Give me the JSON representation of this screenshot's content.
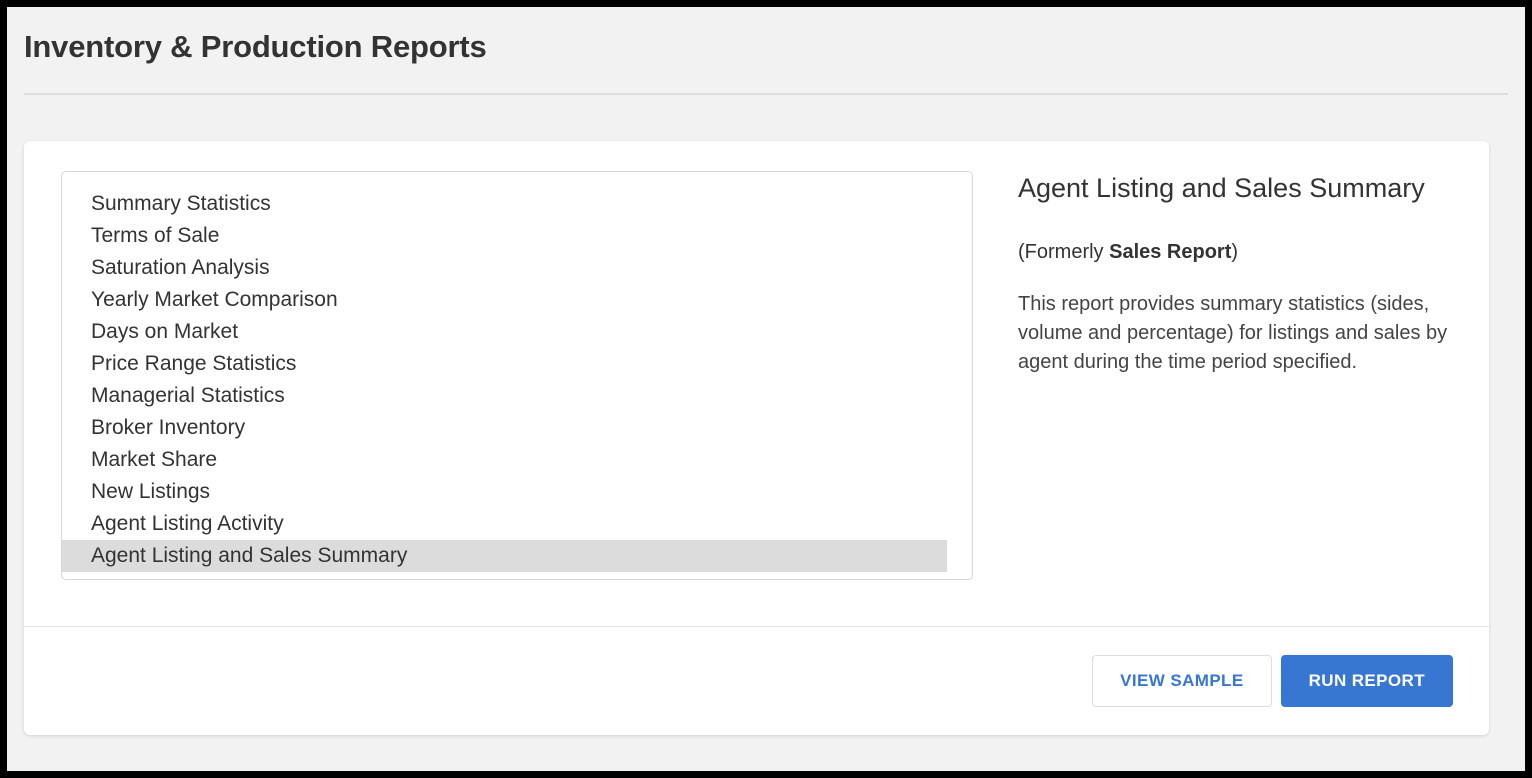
{
  "header": {
    "title": "Inventory & Production Reports"
  },
  "report_list": {
    "selected_index": 11,
    "items": [
      {
        "label": "Summary Statistics"
      },
      {
        "label": "Terms of Sale"
      },
      {
        "label": "Saturation Analysis"
      },
      {
        "label": "Yearly Market Comparison"
      },
      {
        "label": "Days on Market"
      },
      {
        "label": "Price Range Statistics"
      },
      {
        "label": "Managerial Statistics"
      },
      {
        "label": "Broker Inventory"
      },
      {
        "label": "Market Share"
      },
      {
        "label": "New Listings"
      },
      {
        "label": "Agent Listing Activity"
      },
      {
        "label": "Agent Listing and Sales Summary"
      }
    ]
  },
  "detail": {
    "title": "Agent Listing and Sales Summary",
    "formerly_prefix": "(Formerly ",
    "formerly_name": "Sales Report",
    "formerly_suffix": ")",
    "description": "This report provides summary statistics (sides, volume and percentage) for listings and sales by agent during the time period specified."
  },
  "footer": {
    "view_sample_label": "VIEW SAMPLE",
    "run_report_label": "RUN REPORT"
  },
  "colors": {
    "accent_blue": "#3776d1",
    "page_background": "#f2f2f2",
    "selection_highlight": "#dcdcdc",
    "title_text": "#333333"
  }
}
